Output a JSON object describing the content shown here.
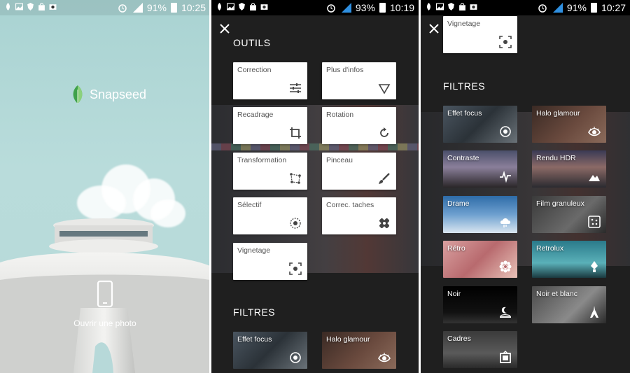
{
  "screens": [
    {
      "status": {
        "battery": "91%",
        "time": "10:25"
      },
      "brand": "Snapseed",
      "open_photo_label": "Ouvrir une photo"
    },
    {
      "status": {
        "battery": "93%",
        "time": "10:19"
      },
      "tools_title": "OUTILS",
      "tools": [
        {
          "label": "Correction",
          "icon": "sliders-icon"
        },
        {
          "label": "Plus d'infos",
          "icon": "triangle-down-icon"
        },
        {
          "label": "Recadrage",
          "icon": "crop-icon"
        },
        {
          "label": "Rotation",
          "icon": "rotate-icon"
        },
        {
          "label": "Transformation",
          "icon": "perspective-icon"
        },
        {
          "label": "Pinceau",
          "icon": "brush-icon"
        },
        {
          "label": "Sélectif",
          "icon": "selective-icon"
        },
        {
          "label": "Correc. taches",
          "icon": "bandage-icon"
        },
        {
          "label": "Vignetage",
          "icon": "vignette-icon"
        }
      ],
      "filters_title": "FILTRES",
      "filters": [
        {
          "label": "Effet focus",
          "icon": "focus-icon"
        },
        {
          "label": "Halo glamour",
          "icon": "eye-icon"
        }
      ]
    },
    {
      "status": {
        "battery": "91%",
        "time": "10:27"
      },
      "tools_partial": {
        "label": "Vignetage",
        "icon": "vignette-icon"
      },
      "filters_title": "FILTRES",
      "filters": [
        {
          "label": "Effet focus",
          "icon": "focus-icon"
        },
        {
          "label": "Halo glamour",
          "icon": "eye-icon"
        },
        {
          "label": "Contraste",
          "icon": "pulse-icon"
        },
        {
          "label": "Rendu HDR",
          "icon": "mountains-icon"
        },
        {
          "label": "Drame",
          "icon": "storm-cloud-icon"
        },
        {
          "label": "Film granuleux",
          "icon": "grain-icon"
        },
        {
          "label": "Rétro",
          "icon": "flower-icon"
        },
        {
          "label": "Retrolux",
          "icon": "retrolux-icon"
        },
        {
          "label": "Noir",
          "icon": "moon-icon"
        },
        {
          "label": "Noir et blanc",
          "icon": "eiffel-icon"
        },
        {
          "label": "Cadres",
          "icon": "frame-icon"
        }
      ]
    }
  ],
  "colors": {
    "sky": "#a9d3d2",
    "dark_bg": "#1f1f1f",
    "card": "#ffffff",
    "brand_green": "#3fa14a"
  }
}
